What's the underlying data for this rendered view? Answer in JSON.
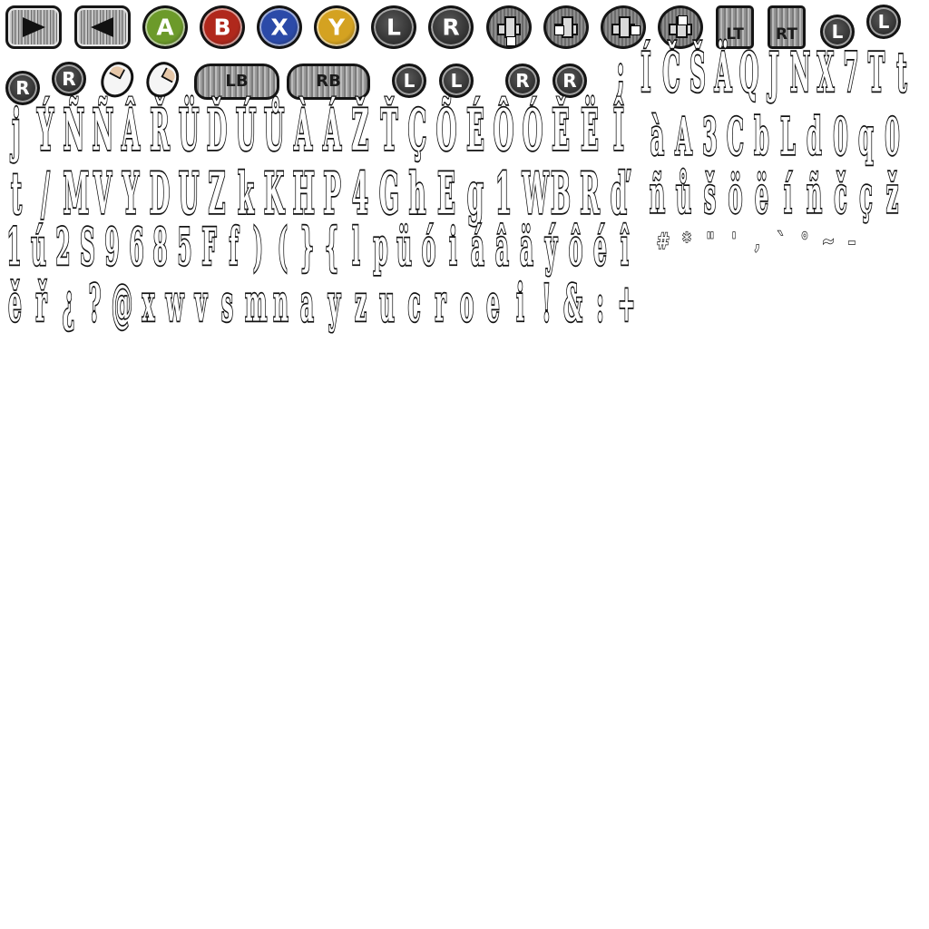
{
  "atlas": {
    "button_sprites": [
      {
        "name": "play-right-button",
        "kind": "rect",
        "icon": "play-right-icon",
        "label": ""
      },
      {
        "name": "play-left-button",
        "kind": "rect",
        "icon": "play-left-icon",
        "label": ""
      },
      {
        "name": "face-button-a",
        "kind": "round",
        "label": "A",
        "color": "#6c9a2a"
      },
      {
        "name": "face-button-b",
        "kind": "round",
        "label": "B",
        "color": "#b0281c"
      },
      {
        "name": "face-button-x",
        "kind": "round",
        "label": "X",
        "color": "#2b4aa8"
      },
      {
        "name": "face-button-y",
        "kind": "round",
        "label": "Y",
        "color": "#d4a221"
      },
      {
        "name": "stick-l-button",
        "kind": "dark-round",
        "label": "L"
      },
      {
        "name": "stick-r-button",
        "kind": "dark-round",
        "label": "R"
      },
      {
        "name": "dpad-down",
        "kind": "dpad",
        "icon": "dpad-down-icon"
      },
      {
        "name": "dpad-left",
        "kind": "dpad",
        "icon": "dpad-left-icon"
      },
      {
        "name": "dpad-right",
        "kind": "dpad",
        "icon": "dpad-right-icon"
      },
      {
        "name": "dpad-up",
        "kind": "dpad",
        "icon": "dpad-up-icon"
      },
      {
        "name": "trigger-lt",
        "kind": "trigger",
        "label": "LT"
      },
      {
        "name": "trigger-rt",
        "kind": "trigger",
        "label": "RT"
      },
      {
        "name": "stick-l-small-a",
        "kind": "dark-round",
        "label": "L"
      },
      {
        "name": "stick-l-small-b",
        "kind": "dark-round",
        "label": "L"
      },
      {
        "name": "stick-r-small-a",
        "kind": "dark-round",
        "label": "R"
      },
      {
        "name": "stick-r-small-b",
        "kind": "dark-round",
        "label": "R"
      },
      {
        "name": "mouse-left-click",
        "kind": "mouse",
        "icon": "mouse-left-icon"
      },
      {
        "name": "mouse-right-click",
        "kind": "mouse",
        "icon": "mouse-right-icon"
      },
      {
        "name": "bumper-lb",
        "kind": "bumper",
        "label": "LB"
      },
      {
        "name": "bumper-rb",
        "kind": "bumper",
        "label": "RB"
      },
      {
        "name": "stick-l-horizontal-a",
        "kind": "dark-round",
        "label": "L"
      },
      {
        "name": "stick-l-horizontal-b",
        "kind": "dark-round",
        "label": "L"
      },
      {
        "name": "stick-r-horizontal-a",
        "kind": "dark-round",
        "label": "R"
      },
      {
        "name": "stick-r-horizontal-b",
        "kind": "dark-round",
        "label": "R"
      }
    ],
    "glyph_rows": [
      {
        "row": "row-1",
        "chars": [
          ";",
          "Í",
          "Č",
          "Š",
          "Ä",
          "Q",
          "J",
          "N",
          "X",
          "7",
          "T",
          "t"
        ]
      },
      {
        "row": "row-2",
        "chars": [
          "j",
          "Ý",
          "Ñ",
          "Ñ",
          "Â",
          "Ř",
          "Ü",
          "Ď",
          "Ú",
          "Ů",
          "À",
          "Á",
          "Ž",
          "Ť",
          "Ç",
          "Õ",
          "É",
          "Ô",
          "Ó",
          "Ě",
          "Ë",
          "Î"
        ]
      },
      {
        "row": "row-2b",
        "chars": [
          "à",
          "A",
          "3",
          "C",
          "b",
          "L",
          "d",
          "0",
          "q",
          "0"
        ]
      },
      {
        "row": "row-3",
        "chars": [
          "t",
          "/",
          "M",
          "V",
          "Y",
          "D",
          "U",
          "Z",
          "k",
          "K",
          "H",
          "P",
          "4",
          "G",
          "h",
          "E",
          "g",
          "1",
          "W",
          "B",
          "R",
          "ď"
        ]
      },
      {
        "row": "row-3b",
        "chars": [
          "ñ",
          "ů",
          "š",
          "ö",
          "ë",
          "í",
          "ñ",
          "č",
          "ç",
          "ž"
        ]
      },
      {
        "row": "row-4",
        "chars": [
          "1",
          "ú",
          "2",
          "S",
          "9",
          "6",
          "8",
          "5",
          "F",
          "f",
          ")",
          "(",
          "}",
          "{",
          "l",
          "p",
          "ü",
          "ó",
          "i",
          "á",
          "â",
          "ä",
          "ý",
          "ô",
          "é",
          "î"
        ]
      },
      {
        "row": "row-4b",
        "chars": [
          "#",
          "*",
          "\"",
          "'",
          ",",
          "`",
          "°",
          "~",
          "–"
        ]
      },
      {
        "row": "row-5",
        "chars": [
          "ě",
          "ř",
          "¿",
          "?",
          "@",
          "x",
          "w",
          "v",
          "s",
          "m",
          "n",
          "a",
          "y",
          "z",
          "u",
          "c",
          "r",
          "o",
          "e",
          "i",
          "!",
          "&",
          ":",
          "+"
        ]
      }
    ]
  }
}
